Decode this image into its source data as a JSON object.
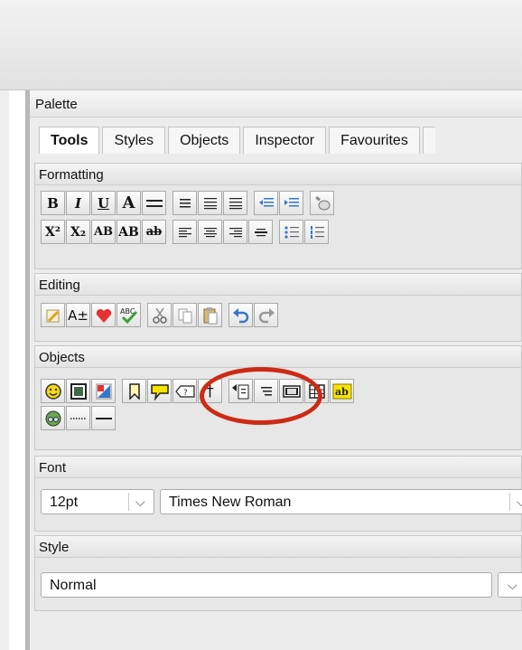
{
  "palette": {
    "title": "Palette",
    "tabs": [
      "Tools",
      "Styles",
      "Objects",
      "Inspector",
      "Favourites"
    ],
    "active_tab": "Tools"
  },
  "sections": {
    "formatting": {
      "title": "Formatting",
      "row1": [
        "B",
        "I",
        "U",
        "A",
        "",
        "",
        "",
        "",
        "",
        "",
        ""
      ],
      "row2": [
        "X²",
        "X₂",
        "AB",
        "AB",
        "ab"
      ]
    },
    "editing": {
      "title": "Editing"
    },
    "objects": {
      "title": "Objects"
    },
    "font": {
      "title": "Font",
      "size_value": "12pt",
      "family_value": "Times New Roman"
    },
    "style": {
      "title": "Style",
      "style_value": "Normal"
    }
  },
  "colors": {
    "highlight": "#cc2a14",
    "heart": "#e63232",
    "note": "#f5e400",
    "undo": "#3a76c9"
  },
  "icons": {
    "editing": [
      "pencil-note-icon",
      "font-size-icon",
      "heart-icon",
      "spellcheck-icon",
      "cut-icon",
      "copy-icon",
      "paste-icon",
      "undo-icon",
      "redo-icon"
    ],
    "objects": [
      "smiley-icon",
      "image-icon",
      "flag-image-icon",
      "bookmark-icon",
      "comment-icon",
      "tag-icon",
      "dagger-icon",
      "insert-field-icon",
      "list-icon",
      "film-icon",
      "table-icon",
      "text-field-icon",
      "equation-icon",
      "dotted-line-icon",
      "horizontal-line-icon"
    ]
  }
}
